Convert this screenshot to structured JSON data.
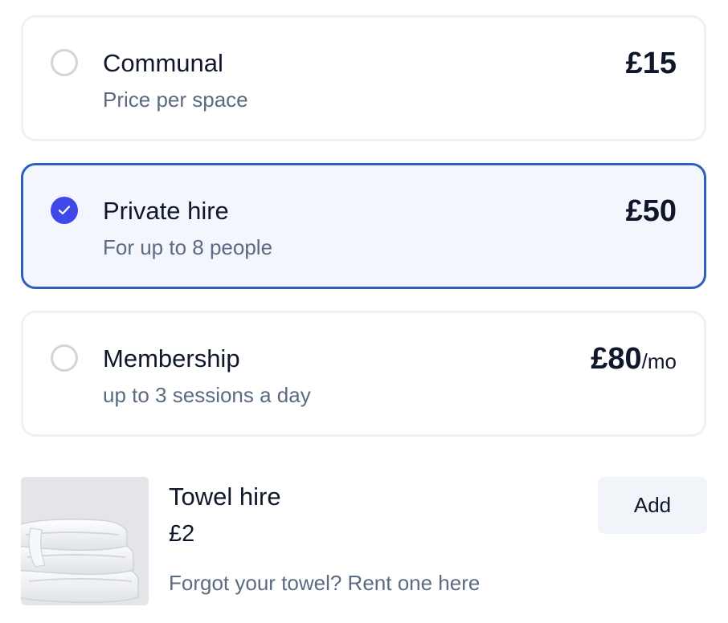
{
  "options": [
    {
      "title": "Communal",
      "subtitle": "Price per space",
      "price": "£15",
      "unit": "",
      "selected": false
    },
    {
      "title": "Private hire",
      "subtitle": "For up to 8 people",
      "price": "£50",
      "unit": "",
      "selected": true
    },
    {
      "title": "Membership",
      "subtitle": "up to 3 sessions a day",
      "price": "£80",
      "unit": "/mo",
      "selected": false
    }
  ],
  "addon": {
    "title": "Towel hire",
    "price": "£2",
    "description": "Forgot your towel? Rent one here",
    "button_label": "Add",
    "image": "folded-towels-image"
  },
  "colors": {
    "accent": "#3f49ea",
    "selected_border": "#2d5fbd",
    "selected_bg": "#f4f6fd",
    "muted_text": "#5b6b82"
  }
}
